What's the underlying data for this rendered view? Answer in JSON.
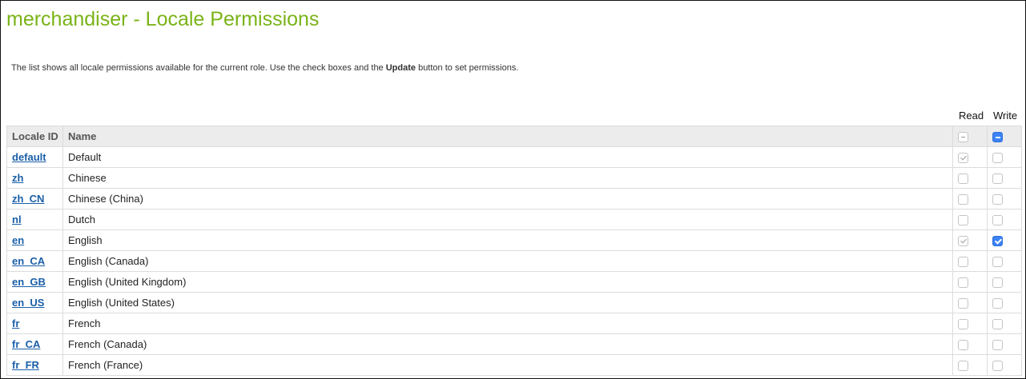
{
  "page": {
    "title": "merchandiser - Locale Permissions",
    "description_before": "The list shows all locale permissions available for the current role. Use the check boxes and the ",
    "description_bold": "Update",
    "description_after": " button to set permissions."
  },
  "permissions_header": {
    "read_label": "Read",
    "write_label": "Write"
  },
  "table": {
    "columns": {
      "locale_id": "Locale ID",
      "name": "Name"
    },
    "header_read_state": "indeterminate-disabled",
    "header_write_state": "indeterminate",
    "rows": [
      {
        "locale_id": "default",
        "name": "Default",
        "read": "checked-disabled",
        "write": "unchecked"
      },
      {
        "locale_id": "zh",
        "name": "Chinese",
        "read": "unchecked",
        "write": "unchecked"
      },
      {
        "locale_id": "zh_CN",
        "name": "Chinese (China)",
        "read": "unchecked",
        "write": "unchecked"
      },
      {
        "locale_id": "nl",
        "name": "Dutch",
        "read": "unchecked",
        "write": "unchecked"
      },
      {
        "locale_id": "en",
        "name": "English",
        "read": "checked-disabled",
        "write": "checked"
      },
      {
        "locale_id": "en_CA",
        "name": "English (Canada)",
        "read": "unchecked",
        "write": "unchecked"
      },
      {
        "locale_id": "en_GB",
        "name": "English (United Kingdom)",
        "read": "unchecked",
        "write": "unchecked"
      },
      {
        "locale_id": "en_US",
        "name": "English (United States)",
        "read": "unchecked",
        "write": "unchecked"
      },
      {
        "locale_id": "fr",
        "name": "French",
        "read": "unchecked",
        "write": "unchecked"
      },
      {
        "locale_id": "fr_CA",
        "name": "French (Canada)",
        "read": "unchecked",
        "write": "unchecked"
      },
      {
        "locale_id": "fr_FR",
        "name": "French (France)",
        "read": "unchecked",
        "write": "unchecked"
      }
    ]
  },
  "colors": {
    "title": "#7ab317",
    "link": "#1a5fa8",
    "header_bg": "#ececec",
    "checkbox_accent": "#3b82f6"
  }
}
